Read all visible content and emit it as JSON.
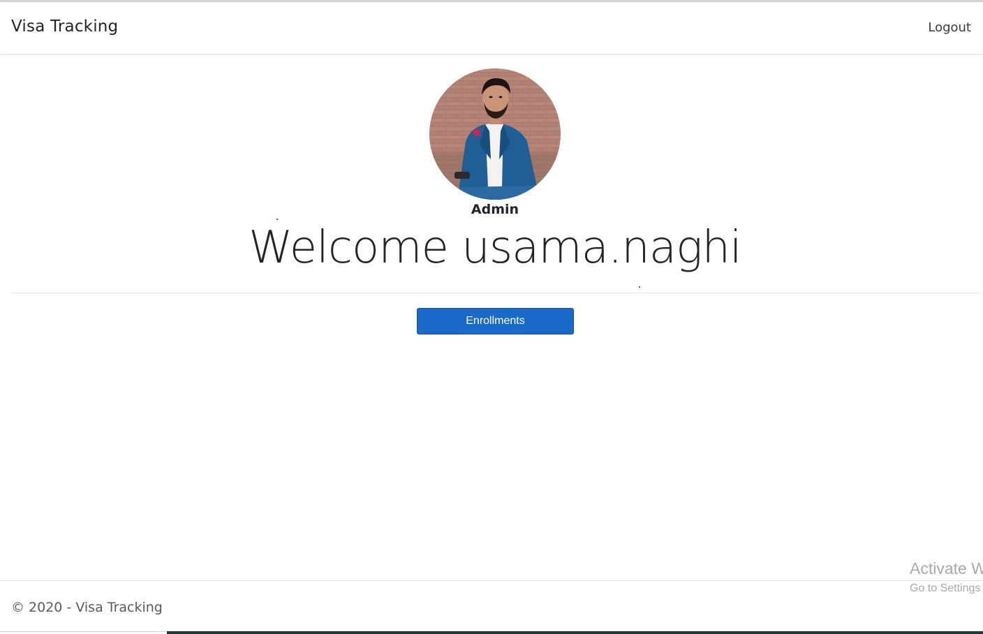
{
  "navbar": {
    "brand": "Visa Tracking",
    "logout_label": "Logout"
  },
  "profile": {
    "role": "Admin",
    "welcome_text": "Welcome usama.naghi"
  },
  "actions": {
    "enrollments_label": "Enrollments"
  },
  "footer": {
    "text": "© 2020 - Visa Tracking"
  },
  "watermark": {
    "line1": "Activate Windows",
    "line2": "Go to Settings to activate Windows."
  },
  "colors": {
    "primary_button": "#1a6ac9",
    "text": "#212529"
  }
}
